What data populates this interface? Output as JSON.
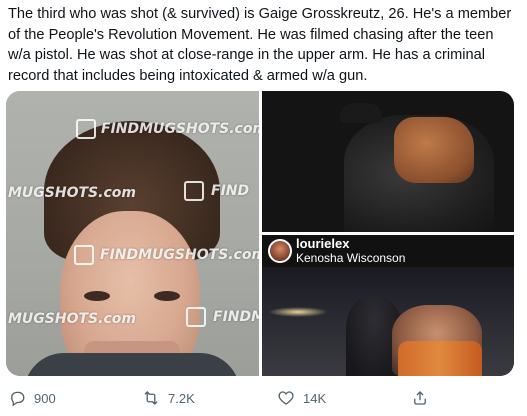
{
  "tweet": {
    "text": "The third who was shot (& survived) is Gaige Grosskreutz, 26. He's a member of the People's Revolution Movement. He was filmed chasing after the teen w/a pistol. He was shot at close-range in the upper arm. He has a criminal record that includes being intoxicated & armed w/a gun."
  },
  "media": {
    "mugshot_watermarks": [
      "FINDMUGSHOTS.com",
      "MUGSHOTS.com",
      "FIND",
      "FINDMUGSHOTS.com",
      "MUGSHOTS.com",
      "FINDM"
    ],
    "instagram": {
      "username": "lourielex",
      "location": "Kenosha Wisconson"
    }
  },
  "actions": {
    "reply_count": "900",
    "retweet_count": "7.2K",
    "like_count": "14K"
  },
  "colors": {
    "text": "#0f1419",
    "icon": "#536471"
  }
}
